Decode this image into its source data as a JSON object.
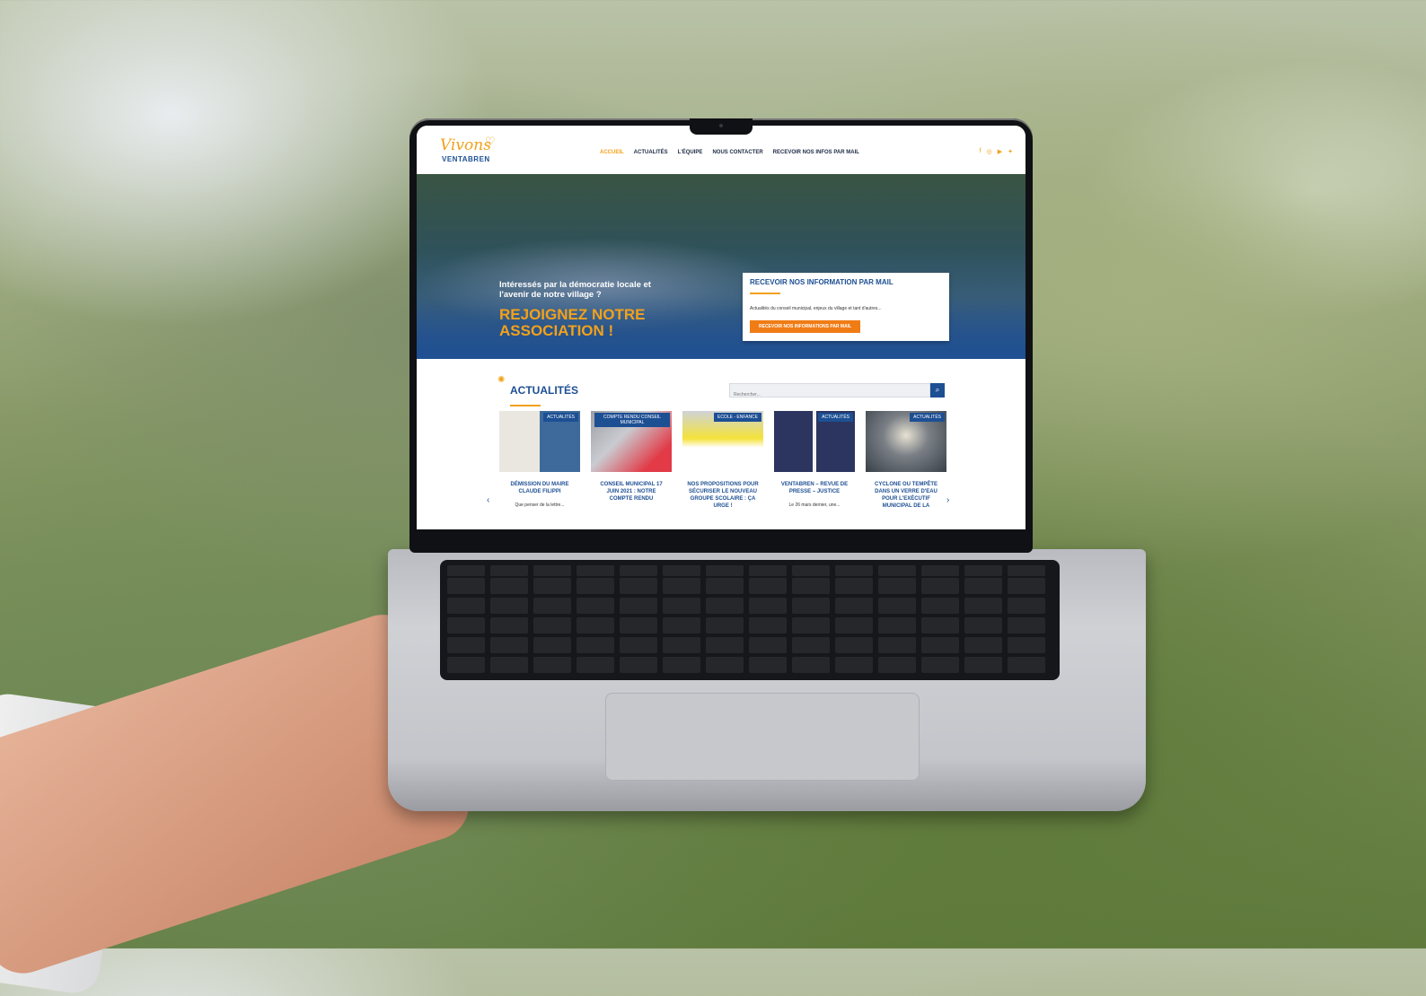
{
  "site": {
    "logo": {
      "script": "Vivons",
      "name": "VENTABREN"
    },
    "menu": [
      "ACCUEIL",
      "ACTUALITÉS",
      "L'ÉQUIPE",
      "NOUS CONTACTER",
      "RECEVOIR NOS INFOS PAR MAIL"
    ],
    "social_icons": [
      "facebook-icon",
      "instagram-icon",
      "youtube-icon",
      "twitter-icon"
    ],
    "hero": {
      "question": "Intéressés par la démocratie locale et l'avenir de notre village ?",
      "cta": "REJOIGNEZ NOTRE ASSOCIATION !"
    },
    "mailbox": {
      "title": "RECEVOIR NOS INFORMATION PAR MAIL",
      "description": "Actualités du conseil municipal, enjeux du village et tant d'autres...",
      "button": "RECEVOIR NOS INFORMATIONS PAR MAIL"
    },
    "news": {
      "title": "ACTUALITÉS",
      "search_placeholder": "Rechercher...",
      "cards": [
        {
          "category": "ACTUALITÉS",
          "title": "DÉMISSION DU MAIRE CLAUDE FILIPPI",
          "excerpt": "Que penser de la lettre..."
        },
        {
          "category": "COMPTE RENDU CONSEIL MUNICIPAL",
          "title": "CONSEIL MUNICIPAL 17 JUIN 2021 : NOTRE COMPTE RENDU",
          "excerpt": ""
        },
        {
          "category": "ECOLE - ENFANCE",
          "title": "NOS PROPOSITIONS POUR SÉCURISER LE NOUVEAU GROUPE SCOLAIRE : ÇA URGE !",
          "excerpt": ""
        },
        {
          "category": "ACTUALITÉS",
          "title": "VENTABREN – REVUE DE PRESSE – JUSTICE",
          "excerpt": "Le 26 mars dernier, une..."
        },
        {
          "category": "ACTUALITÉS",
          "title": "CYCLONE OU TEMPÊTE DANS UN VERRE D'EAU POUR L'EXÉCUTIF MUNICIPAL DE LA",
          "excerpt": ""
        }
      ]
    }
  },
  "colors": {
    "brand_blue": "#1d4f93",
    "brand_orange": "#f2a11b",
    "button_orange": "#f07c15"
  }
}
